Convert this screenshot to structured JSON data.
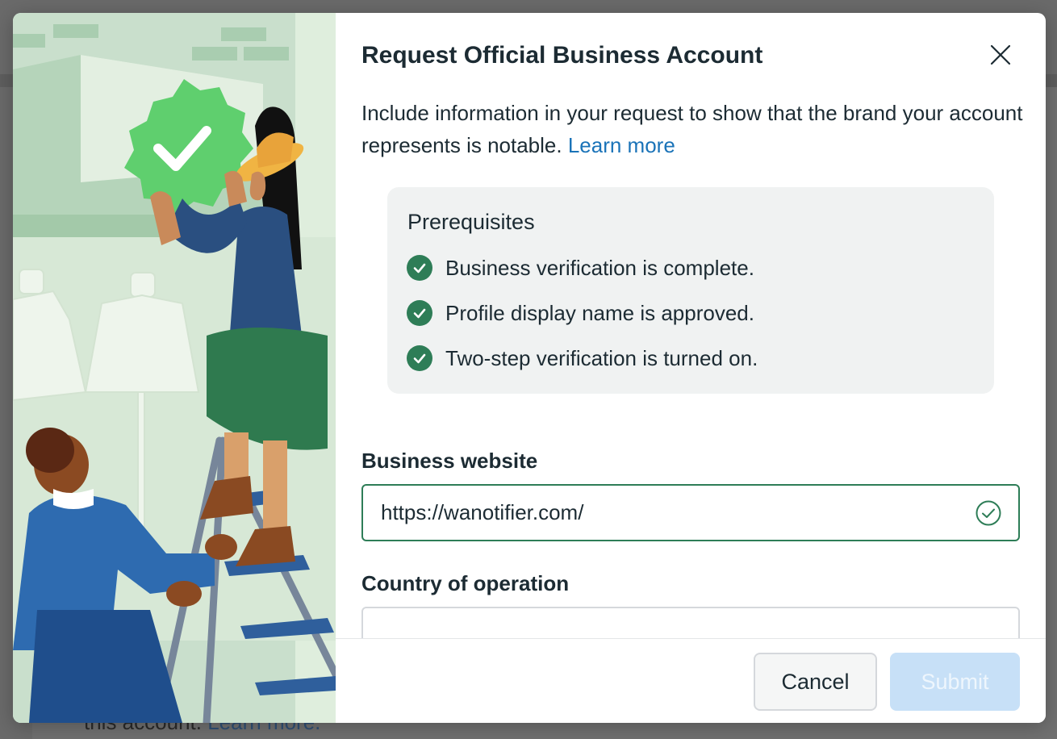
{
  "background": {
    "text": "this account.",
    "link": "Learn more."
  },
  "dialog": {
    "title": "Request Official Business Account",
    "close_icon": "close-icon",
    "intro_text": "Include information in your request to show that the brand your account represents is notable.",
    "intro_link": "Learn more",
    "prerequisites": {
      "title": "Prerequisites",
      "items": [
        {
          "label": "Business verification is complete.",
          "icon": "check-circle-icon"
        },
        {
          "label": "Profile display name is approved.",
          "icon": "check-circle-icon"
        },
        {
          "label": "Two-step verification is turned on.",
          "icon": "check-circle-icon"
        }
      ]
    },
    "website": {
      "label": "Business website",
      "value": "https://wanotifier.com/",
      "status_icon": "valid-check-icon"
    },
    "country": {
      "label": "Country of operation",
      "value": ""
    },
    "footer": {
      "cancel_label": "Cancel",
      "submit_label": "Submit"
    }
  },
  "colors": {
    "accent_green": "#2e7d57",
    "link_blue": "#1a73b8",
    "submit_disabled": "#c7e0f7",
    "badge_green": "#5fcf6e"
  }
}
